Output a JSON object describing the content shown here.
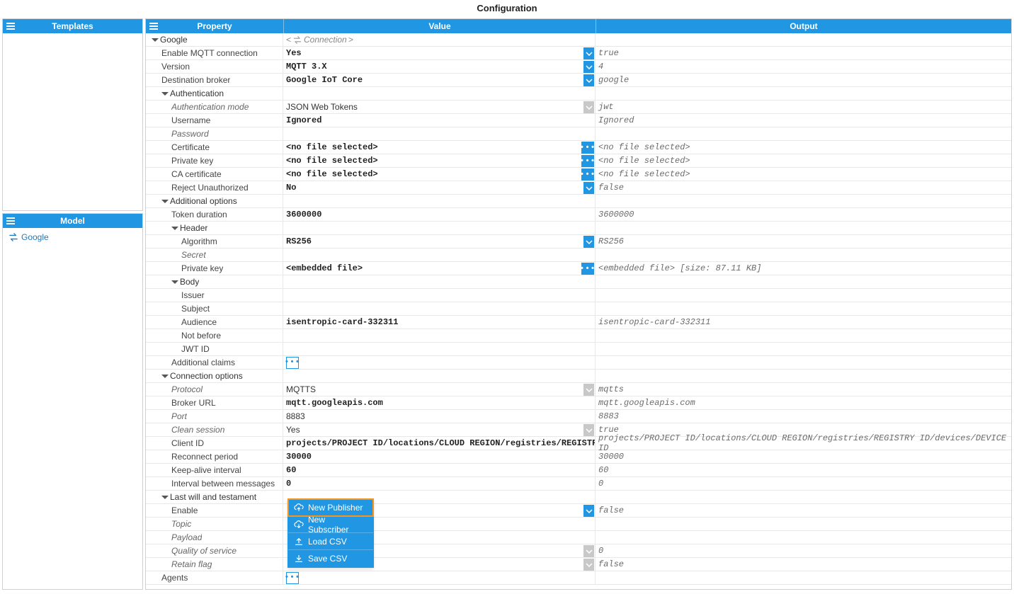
{
  "title": "Configuration",
  "sidebar": {
    "templates_label": "Templates",
    "model_label": "Model",
    "model_items": [
      {
        "label": "Google"
      }
    ]
  },
  "grid": {
    "headers": {
      "property": "Property",
      "value": "Value",
      "output": "Output"
    }
  },
  "rows": [
    {
      "t": "group",
      "d": 0,
      "label": "Google",
      "valueSwap": "Connection"
    },
    {
      "t": "dd",
      "d": 1,
      "label": "Enable MQTT connection",
      "value": "Yes",
      "dd": true,
      "output": "true"
    },
    {
      "t": "dd",
      "d": 1,
      "label": "Version",
      "value": "MQTT 3.X",
      "dd": true,
      "output": "4"
    },
    {
      "t": "dd",
      "d": 1,
      "label": "Destination broker",
      "value": "Google IoT Core",
      "dd": true,
      "output": "google"
    },
    {
      "t": "group",
      "d": 1,
      "label": "Authentication"
    },
    {
      "t": "dd",
      "d": 2,
      "label": "Authentication mode",
      "italic": true,
      "value": "JSON Web Tokens",
      "plain": true,
      "ddDisabled": true,
      "output": "jwt"
    },
    {
      "t": "plain",
      "d": 2,
      "label": "Username",
      "value": "Ignored",
      "output": "Ignored"
    },
    {
      "t": "plain",
      "d": 2,
      "label": "Password",
      "italic": true,
      "value": "",
      "output": ""
    },
    {
      "t": "dots",
      "d": 2,
      "label": "Certificate",
      "value": "<no file selected>",
      "output": "<no file selected>"
    },
    {
      "t": "dots",
      "d": 2,
      "label": "Private key",
      "value": "<no file selected>",
      "output": "<no file selected>"
    },
    {
      "t": "dots",
      "d": 2,
      "label": "CA certificate",
      "value": "<no file selected>",
      "output": "<no file selected>"
    },
    {
      "t": "dd",
      "d": 2,
      "label": "Reject Unauthorized",
      "value": "No",
      "dd": true,
      "output": "false"
    },
    {
      "t": "group",
      "d": 1,
      "label": "Additional options"
    },
    {
      "t": "plain",
      "d": 2,
      "label": "Token duration",
      "value": "3600000",
      "output": "3600000"
    },
    {
      "t": "group",
      "d": 2,
      "label": "Header"
    },
    {
      "t": "dd",
      "d": 3,
      "label": "Algorithm",
      "value": "RS256",
      "dd": true,
      "output": "RS256"
    },
    {
      "t": "plain",
      "d": 3,
      "label": "Secret",
      "italic": true,
      "value": "",
      "output": ""
    },
    {
      "t": "dots",
      "d": 3,
      "label": "Private key",
      "value": "<embedded file>",
      "output": "<embedded file> [size: 87.11 KB]"
    },
    {
      "t": "group",
      "d": 2,
      "label": "Body"
    },
    {
      "t": "plain",
      "d": 3,
      "label": "Issuer",
      "value": "",
      "output": ""
    },
    {
      "t": "plain",
      "d": 3,
      "label": "Subject",
      "value": "",
      "output": ""
    },
    {
      "t": "plain",
      "d": 3,
      "label": "Audience",
      "value": "isentropic-card-332311",
      "output": "isentropic-card-332311"
    },
    {
      "t": "plain",
      "d": 3,
      "label": "Not before",
      "value": "",
      "output": ""
    },
    {
      "t": "plain",
      "d": 3,
      "label": "JWT ID",
      "value": "",
      "output": ""
    },
    {
      "t": "dotsInline",
      "d": 2,
      "label": "Additional claims"
    },
    {
      "t": "group",
      "d": 1,
      "label": "Connection options"
    },
    {
      "t": "dd",
      "d": 2,
      "label": "Protocol",
      "italic": true,
      "value": "MQTTS",
      "plain": true,
      "ddDisabled": true,
      "output": "mqtts"
    },
    {
      "t": "plain",
      "d": 2,
      "label": "Broker URL",
      "value": "mqtt.googleapis.com",
      "output": "mqtt.googleapis.com"
    },
    {
      "t": "plain",
      "d": 2,
      "label": "Port",
      "italic": true,
      "value": "8883",
      "plain": true,
      "output": "8883"
    },
    {
      "t": "dd",
      "d": 2,
      "label": "Clean session",
      "italic": true,
      "value": "Yes",
      "plain": true,
      "ddDisabled": true,
      "output": "true"
    },
    {
      "t": "plain",
      "d": 2,
      "label": "Client ID",
      "value": "projects/PROJECT ID/locations/CLOUD REGION/registries/REGISTRY ID/",
      "output": "projects/PROJECT ID/locations/CLOUD REGION/registries/REGISTRY ID/devices/DEVICE ID"
    },
    {
      "t": "plain",
      "d": 2,
      "label": "Reconnect period",
      "value": "30000",
      "output": "30000"
    },
    {
      "t": "plain",
      "d": 2,
      "label": "Keep-alive interval",
      "value": "60",
      "output": "60"
    },
    {
      "t": "plain",
      "d": 2,
      "label": "Interval between messages",
      "value": "0",
      "output": "0"
    },
    {
      "t": "group",
      "d": 1,
      "label": "Last will and testament"
    },
    {
      "t": "dd",
      "d": 2,
      "label": "Enable",
      "value": "",
      "dd": true,
      "output": "false"
    },
    {
      "t": "plain",
      "d": 2,
      "label": "Topic",
      "italic": true,
      "value": "",
      "output": ""
    },
    {
      "t": "plain",
      "d": 2,
      "label": "Payload",
      "italic": true,
      "value": "",
      "output": ""
    },
    {
      "t": "dd",
      "d": 2,
      "label": "Quality of service",
      "italic": true,
      "value": "",
      "ddDisabled": true,
      "output": "0"
    },
    {
      "t": "dd",
      "d": 2,
      "label": "Retain flag",
      "italic": true,
      "value": "",
      "ddDisabled": true,
      "output": "false"
    },
    {
      "t": "dotsInline",
      "d": 1,
      "label": "Agents"
    }
  ],
  "ctx_menu": {
    "items": [
      {
        "label": "New Publisher",
        "icon": "cloud-up",
        "highlight": true
      },
      {
        "label": "New Subscriber",
        "icon": "cloud-down"
      },
      {
        "label": "Load CSV",
        "icon": "load"
      },
      {
        "label": "Save CSV",
        "icon": "save"
      }
    ]
  }
}
